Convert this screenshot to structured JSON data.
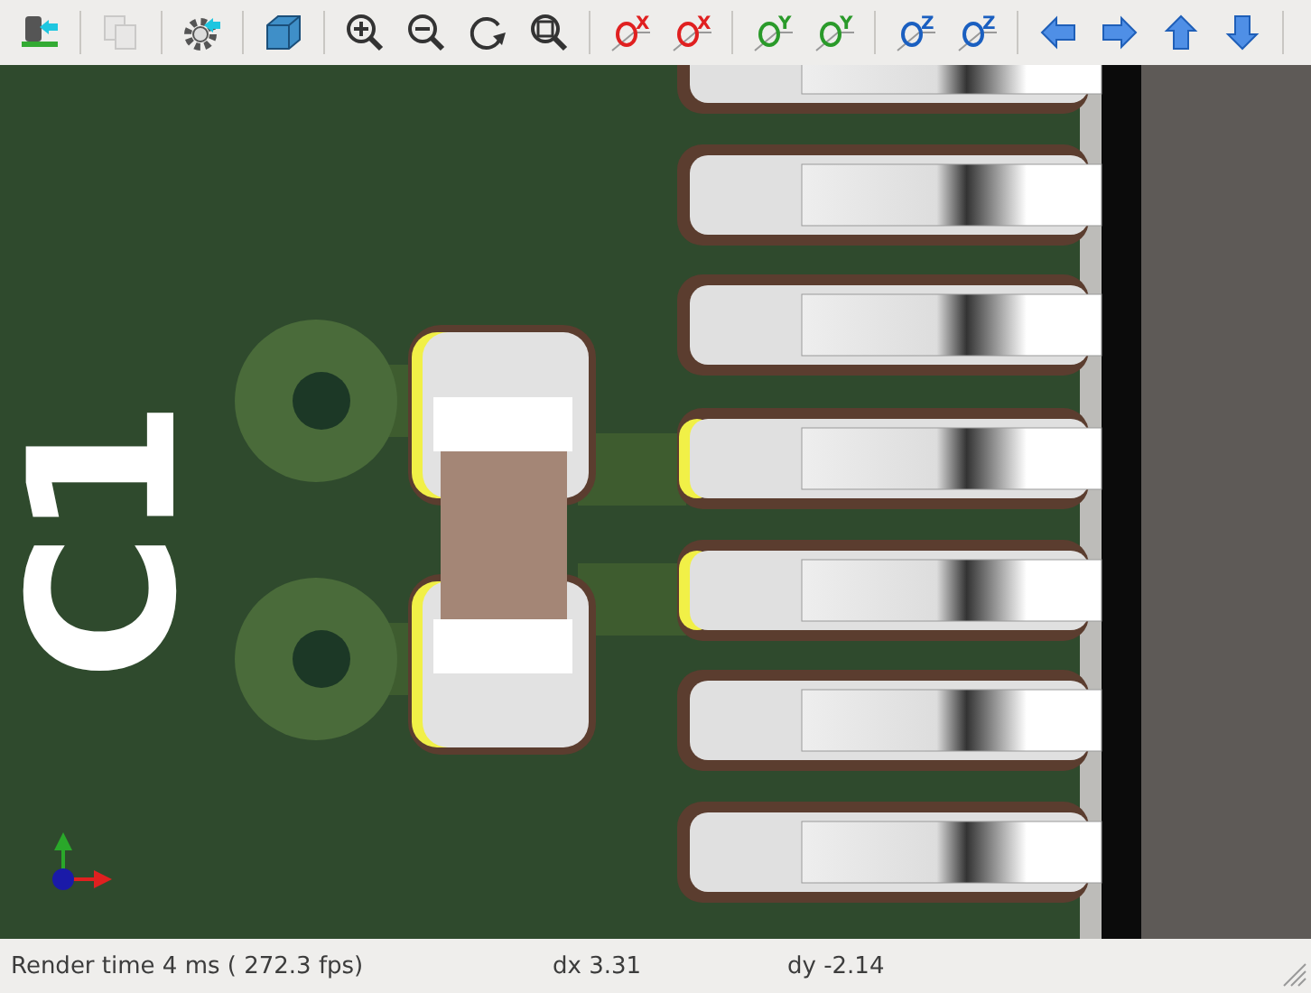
{
  "toolbar": [
    {
      "kind": "insert",
      "disabled": false,
      "group_end": true
    },
    {
      "kind": "copy",
      "disabled": true,
      "group_end": true
    },
    {
      "kind": "gear",
      "disabled": false,
      "group_end": true
    },
    {
      "kind": "cube",
      "disabled": false,
      "group_end": true
    },
    {
      "kind": "zoom-in",
      "disabled": false,
      "group_end": false
    },
    {
      "kind": "zoom-out",
      "disabled": false,
      "group_end": false
    },
    {
      "kind": "redraw",
      "disabled": false,
      "group_end": false
    },
    {
      "kind": "zoom-fit",
      "disabled": false,
      "group_end": true
    },
    {
      "kind": "rotate",
      "axis": "X",
      "disabled": false,
      "group_end": false
    },
    {
      "kind": "rotate",
      "axis": "X",
      "disabled": false,
      "group_end": true
    },
    {
      "kind": "rotate",
      "axis": "Y",
      "disabled": false,
      "group_end": false
    },
    {
      "kind": "rotate",
      "axis": "Y",
      "disabled": false,
      "group_end": true
    },
    {
      "kind": "rotate",
      "axis": "Z",
      "disabled": false,
      "group_end": false
    },
    {
      "kind": "rotate",
      "axis": "Z",
      "disabled": false,
      "group_end": true
    },
    {
      "kind": "left",
      "disabled": false,
      "group_end": false
    },
    {
      "kind": "right",
      "disabled": false,
      "group_end": false
    },
    {
      "kind": "up",
      "disabled": false,
      "group_end": false
    },
    {
      "kind": "down",
      "disabled": false,
      "group_end": true
    }
  ],
  "viewport": {
    "silkscreen_label": "C1"
  },
  "status_bar": {
    "render_time": "Render time 4 ms ( 272.3 fps)",
    "dx": "dx 3.31",
    "dy": "dy -2.14"
  }
}
